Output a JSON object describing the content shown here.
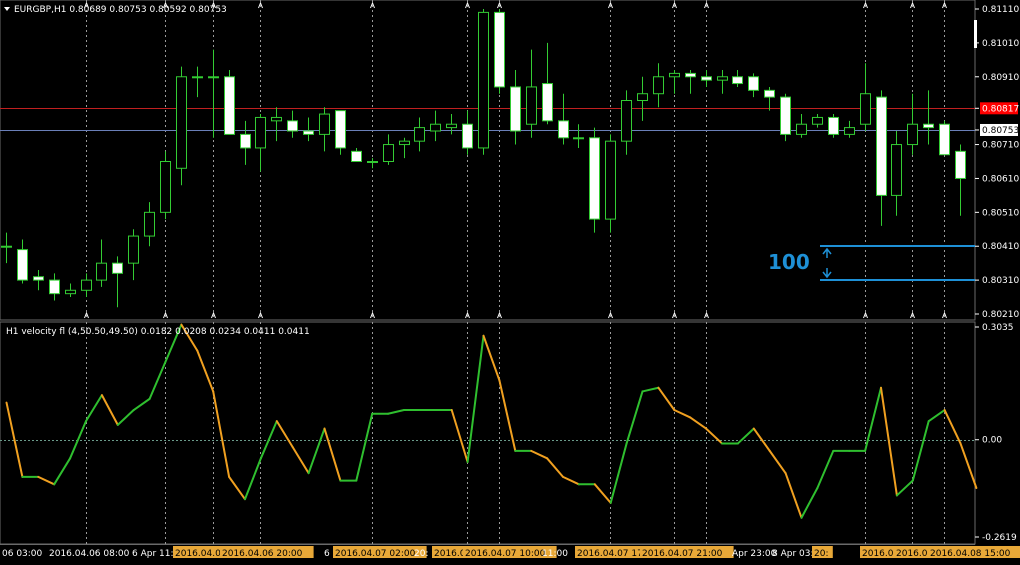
{
  "main_chart": {
    "header": "EURGBP,H1  0.80689 0.80753 0.80592 0.80753",
    "price_labels": [
      "0.81110",
      "0.81010",
      "0.80910",
      "0.80817",
      "0.80753",
      "0.80710",
      "0.80610",
      "0.80510",
      "0.80410",
      "0.80310",
      "0.80210"
    ],
    "price_axis_values": [
      0.8111,
      0.8101,
      0.8091,
      0.80817,
      0.80753,
      0.8071,
      0.8061,
      0.8051,
      0.8041,
      0.8031,
      0.8021
    ],
    "red_line_value": 0.80817,
    "blue_line_value": 0.80753,
    "ask_label_color": "#ff0000",
    "bid_label_color": "#ffffff",
    "annotation_text": "100",
    "annotation_color": "#1e90d6",
    "annotation_upper": 0.8041,
    "annotation_lower": 0.8031
  },
  "indicator": {
    "header": "H1 velocity fl (4,50.50,49.50) 0.0182 0.0208 0.0234 0.0411 0.0411",
    "axis_labels": [
      "0.3035",
      "0.00",
      "-0.2619"
    ],
    "axis_values": [
      0.3035,
      0.0,
      -0.2619
    ],
    "up_color": "#2fbf2f",
    "down_color": "#f0a020"
  },
  "time_axis": {
    "labels": [
      {
        "text": "06 03:00",
        "hl": false
      },
      {
        "text": "2016.04.06 08:00",
        "hl": false
      },
      {
        "text": "6 Apr 11:",
        "hl": false
      },
      {
        "text": "2016.04.06 20:",
        "hl": true
      },
      {
        "text": "2016.04.06 20:00",
        "hl": true
      },
      {
        "text": "6",
        "hl": false
      },
      {
        "text": "2016.04.07 02:00",
        "hl": true
      },
      {
        "text": "20:",
        "hl": false
      },
      {
        "text": "2016.0",
        "hl": true
      },
      {
        "text": "2016.04.07 10:00",
        "hl": true
      },
      {
        "text": "11:00",
        "hl": false
      },
      {
        "text": "2016.04.07 17",
        "hl": true
      },
      {
        "text": "2016.04.07 21:00",
        "hl": true
      },
      {
        "text": "Apr 23:00",
        "hl": false
      },
      {
        "text": "8 Apr 03:",
        "hl": false
      },
      {
        "text": "20:",
        "hl": true
      },
      {
        "text": "2016.0",
        "hl": true
      },
      {
        "text": "2016.0",
        "hl": true
      },
      {
        "text": "2016.04.08 15:00",
        "hl": true
      }
    ]
  },
  "chart_data": [
    {
      "type": "candlestick",
      "title": "EURGBP,H1",
      "ylim": [
        0.8019,
        0.8115
      ],
      "candles": [
        {
          "o": 0.8041,
          "h": 0.8045,
          "l": 0.8036,
          "c": 0.8041
        },
        {
          "o": 0.804,
          "h": 0.8043,
          "l": 0.803,
          "c": 0.8031
        },
        {
          "o": 0.8032,
          "h": 0.8034,
          "l": 0.8028,
          "c": 0.8031
        },
        {
          "o": 0.8031,
          "h": 0.8033,
          "l": 0.8025,
          "c": 0.8027
        },
        {
          "o": 0.8027,
          "h": 0.803,
          "l": 0.8026,
          "c": 0.8028
        },
        {
          "o": 0.8028,
          "h": 0.8033,
          "l": 0.8026,
          "c": 0.8031
        },
        {
          "o": 0.8031,
          "h": 0.8043,
          "l": 0.8029,
          "c": 0.8036
        },
        {
          "o": 0.8036,
          "h": 0.8038,
          "l": 0.8023,
          "c": 0.8033
        },
        {
          "o": 0.8036,
          "h": 0.8046,
          "l": 0.8031,
          "c": 0.8044
        },
        {
          "o": 0.8044,
          "h": 0.8054,
          "l": 0.8041,
          "c": 0.8051
        },
        {
          "o": 0.8051,
          "h": 0.8069,
          "l": 0.8049,
          "c": 0.8066
        },
        {
          "o": 0.8064,
          "h": 0.8094,
          "l": 0.8059,
          "c": 0.8091
        },
        {
          "o": 0.8091,
          "h": 0.8094,
          "l": 0.8085,
          "c": 0.8091
        },
        {
          "o": 0.8091,
          "h": 0.8099,
          "l": 0.8073,
          "c": 0.8091
        },
        {
          "o": 0.8091,
          "h": 0.8093,
          "l": 0.8074,
          "c": 0.8074
        },
        {
          "o": 0.8074,
          "h": 0.8078,
          "l": 0.8065,
          "c": 0.807
        },
        {
          "o": 0.807,
          "h": 0.808,
          "l": 0.8063,
          "c": 0.8079
        },
        {
          "o": 0.8078,
          "h": 0.8082,
          "l": 0.8072,
          "c": 0.8079
        },
        {
          "o": 0.8078,
          "h": 0.8081,
          "l": 0.8073,
          "c": 0.8075
        },
        {
          "o": 0.8075,
          "h": 0.8079,
          "l": 0.8072,
          "c": 0.8074
        },
        {
          "o": 0.8074,
          "h": 0.8082,
          "l": 0.8069,
          "c": 0.808
        },
        {
          "o": 0.8081,
          "h": 0.8081,
          "l": 0.8068,
          "c": 0.807
        },
        {
          "o": 0.8069,
          "h": 0.807,
          "l": 0.8066,
          "c": 0.8066
        },
        {
          "o": 0.8066,
          "h": 0.8067,
          "l": 0.8064,
          "c": 0.8066
        },
        {
          "o": 0.8066,
          "h": 0.8074,
          "l": 0.8065,
          "c": 0.8071
        },
        {
          "o": 0.8071,
          "h": 0.8073,
          "l": 0.8067,
          "c": 0.8072
        },
        {
          "o": 0.8072,
          "h": 0.8079,
          "l": 0.8069,
          "c": 0.8076
        },
        {
          "o": 0.8075,
          "h": 0.8081,
          "l": 0.8072,
          "c": 0.8077
        },
        {
          "o": 0.8076,
          "h": 0.808,
          "l": 0.8074,
          "c": 0.8077
        },
        {
          "o": 0.8077,
          "h": 0.8081,
          "l": 0.8068,
          "c": 0.807
        },
        {
          "o": 0.807,
          "h": 0.8111,
          "l": 0.8068,
          "c": 0.811
        },
        {
          "o": 0.811,
          "h": 0.8111,
          "l": 0.8086,
          "c": 0.8088
        },
        {
          "o": 0.8088,
          "h": 0.8093,
          "l": 0.8071,
          "c": 0.8075
        },
        {
          "o": 0.8077,
          "h": 0.8099,
          "l": 0.8073,
          "c": 0.8088
        },
        {
          "o": 0.8089,
          "h": 0.8101,
          "l": 0.8077,
          "c": 0.8078
        },
        {
          "o": 0.8078,
          "h": 0.8086,
          "l": 0.8071,
          "c": 0.8073
        },
        {
          "o": 0.8073,
          "h": 0.8077,
          "l": 0.807,
          "c": 0.8073
        },
        {
          "o": 0.8073,
          "h": 0.8076,
          "l": 0.8045,
          "c": 0.8049
        },
        {
          "o": 0.8049,
          "h": 0.8074,
          "l": 0.8045,
          "c": 0.8072
        },
        {
          "o": 0.8072,
          "h": 0.8087,
          "l": 0.8068,
          "c": 0.8084
        },
        {
          "o": 0.8084,
          "h": 0.8091,
          "l": 0.8078,
          "c": 0.8086
        },
        {
          "o": 0.8086,
          "h": 0.8095,
          "l": 0.8082,
          "c": 0.8091
        },
        {
          "o": 0.8091,
          "h": 0.8093,
          "l": 0.8086,
          "c": 0.8092
        },
        {
          "o": 0.8092,
          "h": 0.8093,
          "l": 0.8086,
          "c": 0.8091
        },
        {
          "o": 0.8091,
          "h": 0.8093,
          "l": 0.8088,
          "c": 0.809
        },
        {
          "o": 0.809,
          "h": 0.8093,
          "l": 0.8086,
          "c": 0.8091
        },
        {
          "o": 0.8091,
          "h": 0.8093,
          "l": 0.8088,
          "c": 0.8089
        },
        {
          "o": 0.8091,
          "h": 0.8092,
          "l": 0.8085,
          "c": 0.8087
        },
        {
          "o": 0.8087,
          "h": 0.8088,
          "l": 0.8081,
          "c": 0.8085
        },
        {
          "o": 0.8085,
          "h": 0.8086,
          "l": 0.8072,
          "c": 0.8074
        },
        {
          "o": 0.8074,
          "h": 0.808,
          "l": 0.8073,
          "c": 0.8077
        },
        {
          "o": 0.8077,
          "h": 0.808,
          "l": 0.8076,
          "c": 0.8079
        },
        {
          "o": 0.8079,
          "h": 0.808,
          "l": 0.8073,
          "c": 0.8074
        },
        {
          "o": 0.8074,
          "h": 0.8078,
          "l": 0.8073,
          "c": 0.8076
        },
        {
          "o": 0.8077,
          "h": 0.8095,
          "l": 0.8075,
          "c": 0.8086
        },
        {
          "o": 0.8085,
          "h": 0.8087,
          "l": 0.8047,
          "c": 0.8056
        },
        {
          "o": 0.8056,
          "h": 0.8075,
          "l": 0.805,
          "c": 0.8071
        },
        {
          "o": 0.8071,
          "h": 0.8086,
          "l": 0.8068,
          "c": 0.8077
        },
        {
          "o": 0.8077,
          "h": 0.8087,
          "l": 0.8071,
          "c": 0.8076
        },
        {
          "o": 0.8077,
          "h": 0.8078,
          "l": 0.8068,
          "c": 0.8068
        },
        {
          "o": 0.8069,
          "h": 0.8071,
          "l": 0.805,
          "c": 0.8061
        }
      ]
    },
    {
      "type": "line",
      "title": "H1 velocity fl (4,50.50,49.50)",
      "ylim": [
        -0.2619,
        0.3035
      ],
      "values": [
        0.1,
        -0.1,
        -0.1,
        -0.12,
        -0.05,
        0.05,
        0.12,
        0.04,
        0.08,
        0.11,
        0.21,
        0.31,
        0.24,
        0.13,
        -0.1,
        -0.16,
        -0.05,
        0.05,
        -0.02,
        -0.09,
        0.03,
        -0.11,
        -0.11,
        0.07,
        0.07,
        0.08,
        0.08,
        0.08,
        0.08,
        -0.06,
        0.28,
        0.16,
        -0.03,
        -0.03,
        -0.05,
        -0.1,
        -0.12,
        -0.12,
        -0.17,
        -0.01,
        0.13,
        0.14,
        0.08,
        0.06,
        0.03,
        -0.01,
        -0.01,
        0.03,
        -0.03,
        -0.09,
        -0.21,
        -0.13,
        -0.03,
        -0.03,
        -0.03,
        0.14,
        -0.15,
        -0.11,
        0.05,
        0.08,
        -0.01,
        -0.13
      ]
    }
  ]
}
